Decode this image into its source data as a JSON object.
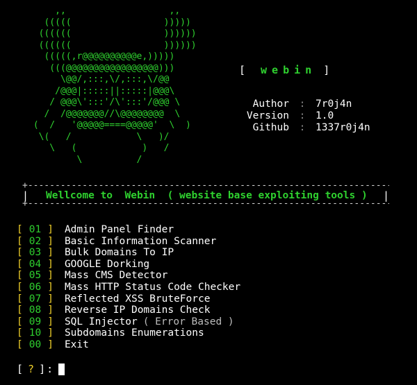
{
  "ascii_art": [
    "     ,,                   ,,",
    "   (((((                 )))))",
    "  ((((((                 ))))))",
    "  ((((((                 ))))))",
    "   (((((,r@@@@@@@@@@e,)))))",
    "    (((@@@@@@@@@@@@@@@@@)))",
    "      \\@@/,:::,\\/,:::,\\/@@",
    "     /@@@|:::::||:::::|@@@\\",
    "    / @@@\\':::'/\\':::'/@@@ \\",
    "   /  /@@@@@@@//\\@@@@@@@@  \\",
    " (  /   '@@@@@====@@@@@'  \\  )",
    "  \\(   /            \\   )/",
    "    \\   (            )   /",
    "         \\          /"
  ],
  "app": {
    "open_bracket": "[",
    "name": "webin",
    "close_bracket": "]"
  },
  "info": [
    {
      "key": "Author",
      "sep": ":",
      "value": "7r0j4n"
    },
    {
      "key": "Version",
      "sep": ":",
      "value": "1.0"
    },
    {
      "key": "Github",
      "sep": ":",
      "value": "1337r0j4n"
    }
  ],
  "banner": {
    "border": "+-----------------------------------------------------------------------------+",
    "left_bar": "|",
    "text": "Wellcome to  Webin  ( website base exploiting tools )",
    "right_bar": "|"
  },
  "menu": [
    {
      "num": "01",
      "label": "Admin Panel Finder",
      "hint": ""
    },
    {
      "num": "02",
      "label": "Basic Information Scanner",
      "hint": ""
    },
    {
      "num": "03",
      "label": "Bulk Domains To IP",
      "hint": ""
    },
    {
      "num": "04",
      "label": "GOOGLE Dorking",
      "hint": ""
    },
    {
      "num": "05",
      "label": "Mass CMS Detector",
      "hint": ""
    },
    {
      "num": "06",
      "label": "Mass HTTP Status Code Checker",
      "hint": ""
    },
    {
      "num": "07",
      "label": "Reflected XSS BruteForce",
      "hint": ""
    },
    {
      "num": "08",
      "label": "Reverse IP Domains Check",
      "hint": ""
    },
    {
      "num": "09",
      "label": "SQL Injector",
      "hint": "( Error Based )"
    },
    {
      "num": "10",
      "label": "Subdomains Enumerations",
      "hint": ""
    },
    {
      "num": "00",
      "label": "Exit",
      "hint": ""
    }
  ],
  "menu_brackets": {
    "open": "[",
    "close": "]"
  },
  "prompt": {
    "open": "[",
    "symbol": "?",
    "close": "]",
    "colon": ":"
  },
  "colors": {
    "background": "#000000",
    "accent_green": "#2fd12f",
    "bracket_yellow": "#f0d02a",
    "text_white": "#ffffff"
  }
}
